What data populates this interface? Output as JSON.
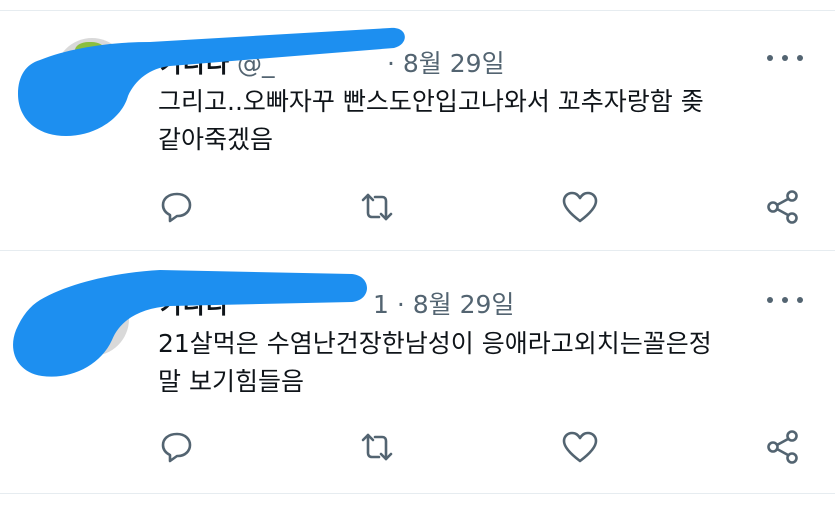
{
  "tweets": [
    {
      "name": "가나다",
      "handle": "@_",
      "sep": "·",
      "date": "8월 29일",
      "text_line1": "그리고..오빠자꾸 빤스도안입고나와서 꼬추자랑함 좆",
      "text_line2": "같아죽겠음"
    },
    {
      "name": "가나다",
      "handle": "1",
      "sep": "·",
      "date": "8월 29일",
      "text_line1": "21살먹은 수염난건장한남성이 응애라고외치는꼴은정",
      "text_line2": "말 보기힘들음"
    }
  ],
  "icons": [
    "more-icon",
    "reply-icon",
    "retweet-icon",
    "like-icon",
    "share-icon"
  ],
  "colors": {
    "text": "#0f1419",
    "muted": "#536471",
    "divider": "#e6ecf0",
    "redaction": "#1d8ff0"
  }
}
